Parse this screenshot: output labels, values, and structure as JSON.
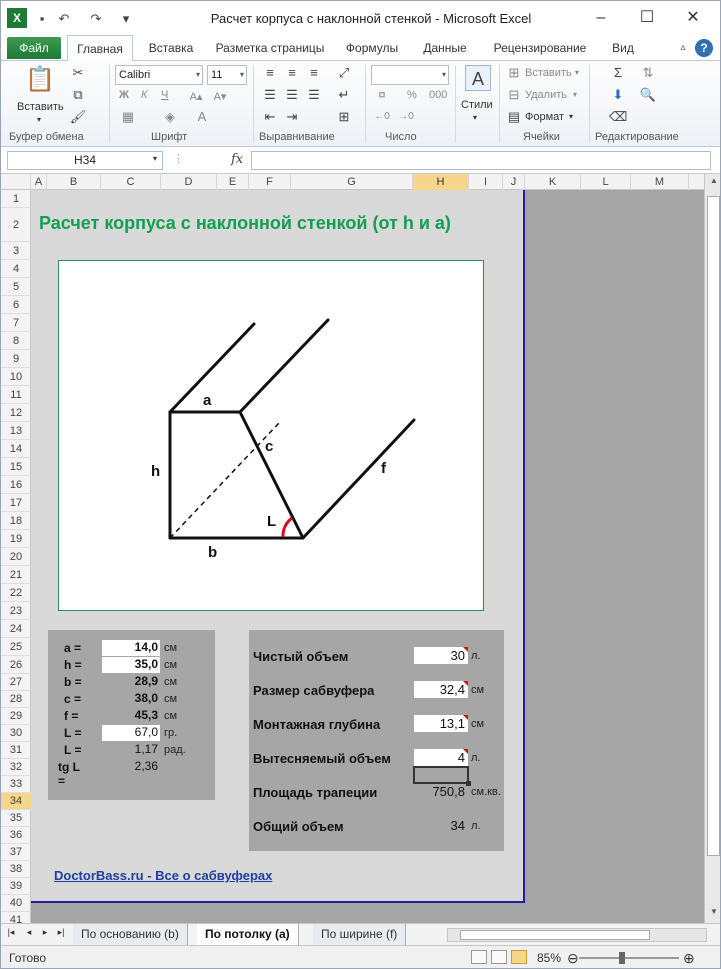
{
  "window": {
    "title": "Расчет корпуса с наклонной стенкой  -  Microsoft Excel",
    "minimize": "–",
    "maximize": "☐",
    "close": "✕"
  },
  "ribbon": {
    "tabs": [
      "Файл",
      "Главная",
      "Вставка",
      "Разметка страницы",
      "Формулы",
      "Данные",
      "Рецензирование",
      "Вид"
    ],
    "groups": {
      "clipboard": "Буфер обмена",
      "font": "Шрифт",
      "alignment": "Выравнивание",
      "number": "Число",
      "cells": "Ячейки",
      "editing": "Редактирование"
    },
    "paste_label": "Вставить",
    "font_name": "Calibri",
    "font_size": "11",
    "bold": "Ж",
    "italic": "К",
    "underline": "Ч",
    "styles_label": "Стили",
    "insert_label": "Вставить",
    "delete_label": "Удалить",
    "format_label": "Формат",
    "percent": "%",
    "thousands": "000"
  },
  "formula_bar": {
    "name_box": "H34",
    "fx": "fx",
    "formula": ""
  },
  "columns": [
    "A",
    "B",
    "C",
    "D",
    "E",
    "F",
    "G",
    "H",
    "I",
    "J",
    "K",
    "L",
    "M"
  ],
  "selected_column": "H",
  "rows": [
    "1",
    "2",
    "3",
    "4",
    "5",
    "6",
    "7",
    "8",
    "9",
    "10",
    "11",
    "12",
    "13",
    "14",
    "15",
    "16",
    "17",
    "18",
    "19",
    "20",
    "21",
    "22",
    "23",
    "24",
    "25",
    "26",
    "27",
    "28",
    "29",
    "30",
    "31",
    "32",
    "33",
    "34",
    "35",
    "36",
    "37",
    "38",
    "39",
    "40",
    "41"
  ],
  "selected_row": "34",
  "sheet": {
    "title": "Расчет корпуса с наклонной стенкой (от h и a)",
    "diagram_labels": {
      "a": "a",
      "b": "b",
      "c": "c",
      "h": "h",
      "f": "f",
      "L": "L"
    },
    "params": [
      {
        "name": "a =",
        "value": "14,0",
        "unit": "см",
        "input": true,
        "bold": true
      },
      {
        "name": "h =",
        "value": "35,0",
        "unit": "см",
        "input": true,
        "bold": true
      },
      {
        "name": "b =",
        "value": "28,9",
        "unit": "см",
        "input": false,
        "bold": true
      },
      {
        "name": "c =",
        "value": "38,0",
        "unit": "см",
        "input": false,
        "bold": true
      },
      {
        "name": "f =",
        "value": "45,3",
        "unit": "см",
        "input": false,
        "bold": true
      },
      {
        "name": "L =",
        "value": "67,0",
        "unit": "гр.",
        "input": true,
        "bold": false
      },
      {
        "name": "L =",
        "value": "1,17",
        "unit": "рад.",
        "input": false,
        "bold": false
      },
      {
        "name": "tg L =",
        "value": "2,36",
        "unit": "",
        "input": false,
        "bold": false
      }
    ],
    "results": [
      {
        "name": "Чистый объем",
        "value": "30",
        "unit": "л.",
        "input": true
      },
      {
        "name": "Размер сабвуфера",
        "value": "32,4",
        "unit": "см",
        "input": true
      },
      {
        "name": "Монтажная глубина",
        "value": "13,1",
        "unit": "см",
        "input": true
      },
      {
        "name": "Вытесняемый объем",
        "value": "4",
        "unit": "л.",
        "input": true
      },
      {
        "name": "Площадь трапеции",
        "value": "750,8",
        "unit": "см.кв.",
        "input": false
      },
      {
        "name": "Общий объем",
        "value": "34",
        "unit": "л.",
        "input": false
      }
    ],
    "link": "DoctorBass.ru - Все о сабвуферах"
  },
  "sheet_tabs": [
    "По основанию (b)",
    "По потолку (a)",
    "По ширине (f)"
  ],
  "active_sheet_tab": "По потолку (a)",
  "status": {
    "text": "Готово",
    "zoom": "85%"
  }
}
